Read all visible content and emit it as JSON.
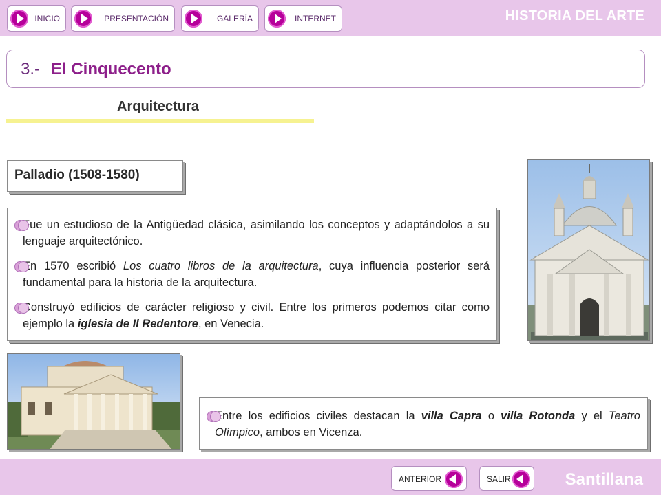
{
  "header": {
    "nav": [
      {
        "label": "INICIO"
      },
      {
        "label": "PRESENTACIÓN"
      },
      {
        "label": "GALERÍA"
      },
      {
        "label": "INTERNET"
      }
    ],
    "brand": "HISTORIA DEL ARTE"
  },
  "slide": {
    "number": "3.-",
    "title": "El Cinquecento",
    "subtitle": "Arquitectura",
    "architect": "Palladio (1508-1580)",
    "paragraphs": [
      {
        "parts": [
          {
            "t": "Fue un estudioso de la Antigüedad clásica, asimilando los conceptos y adaptándolos a su lenguaje arquitectónico."
          }
        ]
      },
      {
        "parts": [
          {
            "t": "En 1570 escribió "
          },
          {
            "t": "Los cuatro libros de la arquitectura",
            "i": true
          },
          {
            "t": ", cuya influencia posterior será fundamental para la historia de la arquitectura."
          }
        ]
      },
      {
        "parts": [
          {
            "t": "Construyó edificios de carácter religioso y civil. Entre los primeros podemos citar como ejemplo la "
          },
          {
            "t": "iglesia de Il Redentore",
            "i": true,
            "b": true
          },
          {
            "t": ", en Venecia."
          }
        ]
      }
    ],
    "civil": [
      {
        "parts": [
          {
            "t": "Entre los edificios civiles destacan la "
          },
          {
            "t": "villa Capra",
            "i": true,
            "b": true
          },
          {
            "t": " o "
          },
          {
            "t": "villa Rotonda",
            "i": true,
            "b": true
          },
          {
            "t": " y el "
          },
          {
            "t": "Teatro Olímpico",
            "i": true
          },
          {
            "t": ", ambos en Vicenza."
          }
        ]
      }
    ]
  },
  "footer": {
    "prev_label": "ANTERIOR",
    "exit_label": "SALIR",
    "brand": "Santillana"
  },
  "colors": {
    "bar": "#e8c6ea",
    "accent": "#b6009a",
    "title": "#8d1f8a",
    "underline": "#f6f291"
  }
}
